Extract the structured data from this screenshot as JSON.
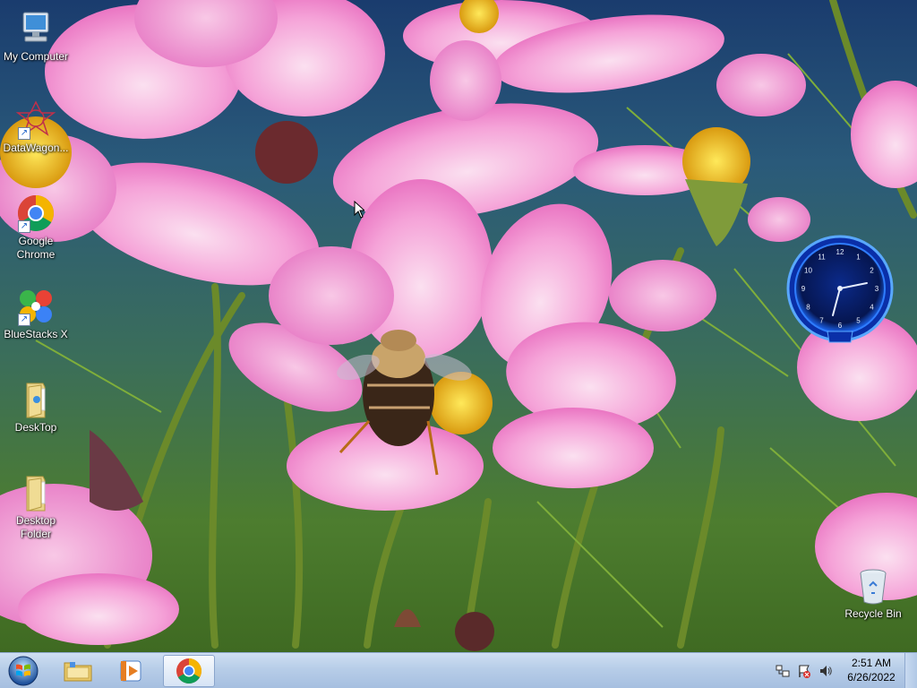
{
  "desktop": {
    "icons": [
      {
        "label": "My Computer",
        "icon": "computer-icon"
      },
      {
        "label": "DataWagon...",
        "icon": "datawagon-icon"
      },
      {
        "label": "Google Chrome",
        "icon": "chrome-icon"
      },
      {
        "label": "BlueStacks X",
        "icon": "bluestacks-icon"
      },
      {
        "label": "DeskTop",
        "icon": "folder-icon"
      },
      {
        "label": "Desktop Folder",
        "icon": "folder-icon"
      },
      {
        "label": "Recycle Bin",
        "icon": "recycle-bin-icon"
      }
    ]
  },
  "gadget": {
    "clock_numerals": [
      "12",
      "1",
      "2",
      "3",
      "4",
      "5",
      "6",
      "7",
      "8",
      "9",
      "10",
      "11"
    ],
    "time": "2:51"
  },
  "taskbar": {
    "start_icon": "windows-start-icon",
    "pinned": [
      {
        "name": "explorer",
        "icon": "folder-icon"
      },
      {
        "name": "media-player",
        "icon": "media-player-icon"
      },
      {
        "name": "chrome",
        "icon": "chrome-icon",
        "active": true
      }
    ],
    "tray_icons": [
      "network-icon",
      "flag-icon",
      "volume-icon"
    ],
    "time": "2:51 AM",
    "date": "6/26/2022"
  },
  "colors": {
    "taskbar": "#b7cde8",
    "clock_accent": "#1e6cff",
    "flower_pink": "#f07ac6"
  }
}
